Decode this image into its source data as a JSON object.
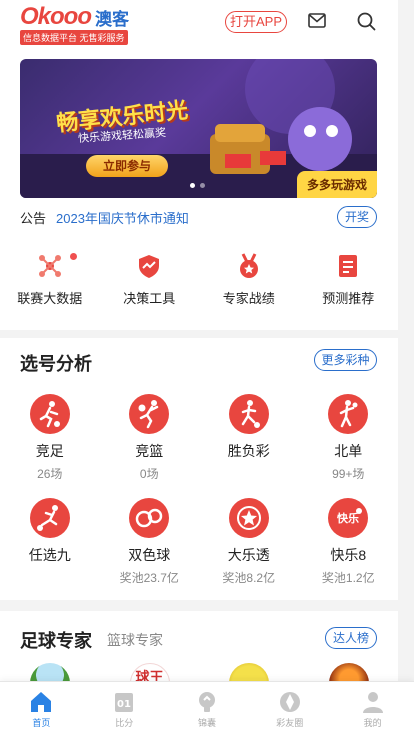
{
  "header": {
    "logo_main": "Okooo",
    "logo_cn": "澳客",
    "logo_tagline": "信息数据平台 无售彩服务",
    "open_app_label": "打开APP",
    "icons": [
      "mail-icon",
      "search-icon"
    ]
  },
  "banner": {
    "title": "畅享欢乐时光",
    "subtitle": "快乐游戏轻松赢奖",
    "button_label": "立即参与",
    "tag": "多多玩游戏",
    "dots": 2,
    "active_dot": 0
  },
  "notice": {
    "label": "公告",
    "text": "2023年国庆节休市通知",
    "button_label": "开奖"
  },
  "quick_links": [
    {
      "label": "联赛大数据",
      "icon": "network-icon",
      "badge": true
    },
    {
      "label": "决策工具",
      "icon": "shield-chart-icon",
      "badge": false
    },
    {
      "label": "专家战绩",
      "icon": "medal-icon",
      "badge": false
    },
    {
      "label": "预测推荐",
      "icon": "document-icon",
      "badge": false
    }
  ],
  "lottery_section": {
    "title": "选号分析",
    "more_label": "更多彩种",
    "items": [
      {
        "name": "竞足",
        "sub": "26场",
        "icon": "soccer-player-icon"
      },
      {
        "name": "竞篮",
        "sub": "0场",
        "icon": "basketball-player-icon"
      },
      {
        "name": "胜负彩",
        "sub": "",
        "icon": "soccer-kick-icon"
      },
      {
        "name": "北单",
        "sub": "99+场",
        "icon": "runner-icon"
      },
      {
        "name": "任选九",
        "sub": "",
        "icon": "football-kick-icon"
      },
      {
        "name": "双色球",
        "sub": "奖池23.7亿",
        "icon": "double-ball-icon"
      },
      {
        "name": "大乐透",
        "sub": "奖池8.2亿",
        "icon": "star-ball-icon"
      },
      {
        "name": "快乐8",
        "sub": "奖池1.2亿",
        "icon": "happy8-icon"
      }
    ],
    "happy8_icon_text": "快乐"
  },
  "expert_section": {
    "title": "足球专家",
    "tab2": "篮球专家",
    "ranking_label": "达人榜",
    "avatar2_text": "球王"
  },
  "tabbar": [
    {
      "label": "首页",
      "icon": "home-icon",
      "active": true
    },
    {
      "label": "比分",
      "icon": "scoreboard-icon",
      "active": false
    },
    {
      "label": "锦囊",
      "icon": "bulb-icon",
      "active": false
    },
    {
      "label": "彩友圈",
      "icon": "aperture-icon",
      "active": false
    },
    {
      "label": "我的",
      "icon": "user-icon",
      "active": false
    }
  ],
  "colors": {
    "brand_red": "#e8463f",
    "brand_blue": "#2a6ecb",
    "tab_active": "#2a82e4"
  }
}
